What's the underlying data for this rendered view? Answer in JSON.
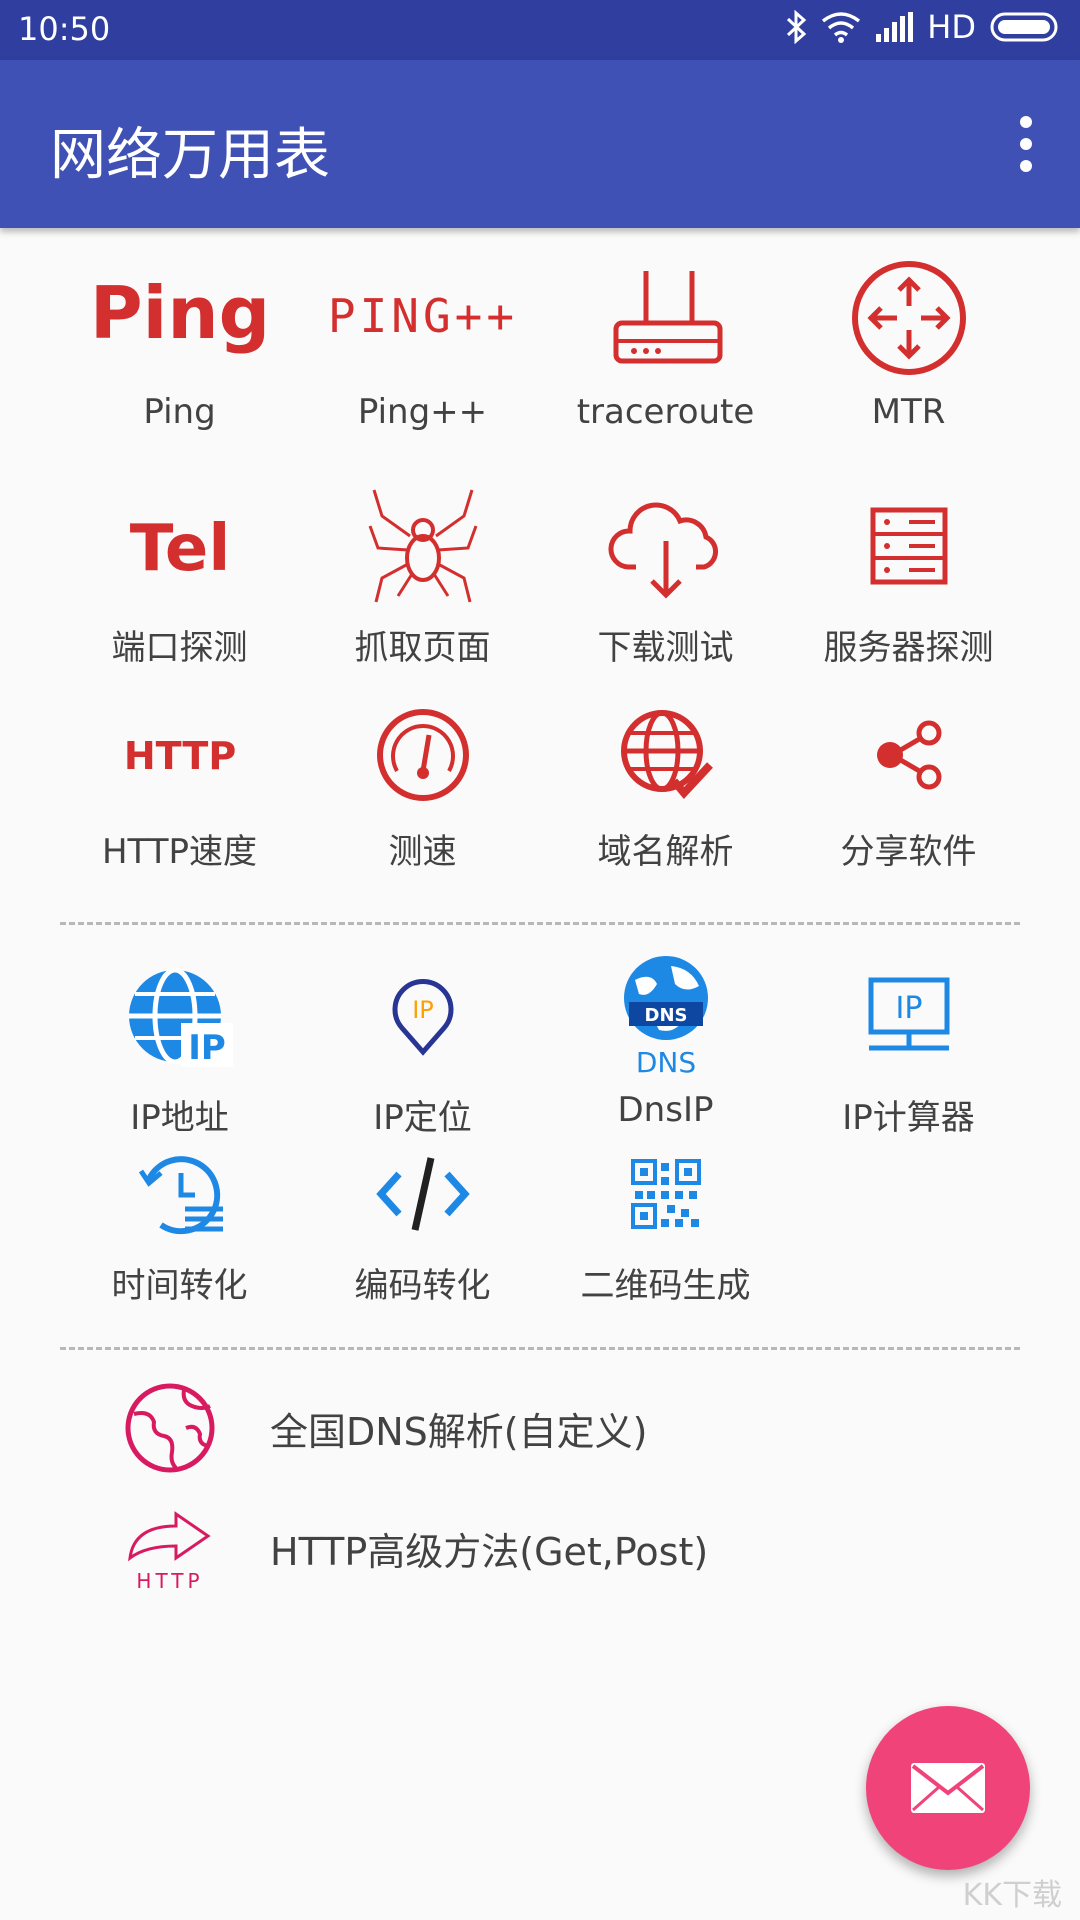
{
  "status_bar": {
    "time": "10:50",
    "network": "HD"
  },
  "app_bar": {
    "title": "网络万用表"
  },
  "network_tools": [
    {
      "label": "Ping",
      "icon": "ping-logo-icon",
      "icon_text": "Ping"
    },
    {
      "label": "Ping++",
      "icon": "ping-plus-logo-icon",
      "icon_text": "PING++"
    },
    {
      "label": "traceroute",
      "icon": "router-icon"
    },
    {
      "label": "MTR",
      "icon": "mtr-arrows-icon"
    },
    {
      "label": "端口探测",
      "icon": "tel-icon",
      "icon_text": "Tel"
    },
    {
      "label": "抓取页面",
      "icon": "spider-icon"
    },
    {
      "label": "下载测试",
      "icon": "cloud-download-icon"
    },
    {
      "label": "服务器探测",
      "icon": "server-icon"
    },
    {
      "label": "HTTP速度",
      "icon": "http-logo-icon",
      "icon_text": "HTTP"
    },
    {
      "label": "测速",
      "icon": "speedometer-icon"
    },
    {
      "label": "域名解析",
      "icon": "globe-check-icon"
    },
    {
      "label": "分享软件",
      "icon": "share-icon"
    }
  ],
  "ip_tools": [
    {
      "label": "IP地址",
      "icon": "globe-ip-icon",
      "icon_text": "IP"
    },
    {
      "label": "IP定位",
      "icon": "ip-location-pin-icon",
      "icon_text": "IP"
    },
    {
      "label": "DnsIP",
      "icon": "dns-globe-icon",
      "icon_text": "DNS"
    },
    {
      "label": "IP计算器",
      "icon": "ip-monitor-icon",
      "icon_text": "IP"
    },
    {
      "label": "时间转化",
      "icon": "time-history-icon"
    },
    {
      "label": "编码转化",
      "icon": "code-icon"
    },
    {
      "label": "二维码生成",
      "icon": "qr-code-icon"
    }
  ],
  "list_items": [
    {
      "label": "全国DNS解析(自定义)",
      "icon": "planet-icon"
    },
    {
      "label": "HTTP高级方法(Get,Post)",
      "icon": "http-forward-icon",
      "icon_text": "HTTP"
    }
  ],
  "fab": {
    "icon": "mail-icon"
  },
  "watermark": {
    "text": "KK下载"
  },
  "colors": {
    "status_bar": "#303f9f",
    "app_bar": "#3f51b5",
    "tool_red": "#d32f2f",
    "ip_blue": "#1e88e5",
    "list_pink": "#d81b60",
    "fab": "#f0437a"
  }
}
